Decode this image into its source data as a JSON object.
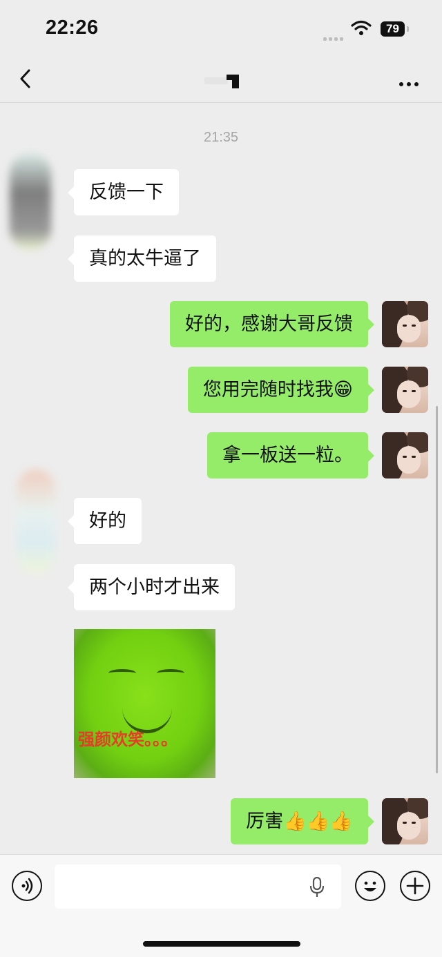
{
  "status_bar": {
    "time": "22:26",
    "battery": "79"
  },
  "chat": {
    "timestamp": "21:35",
    "messages": [
      {
        "side": "in",
        "text": "反馈一下"
      },
      {
        "side": "in",
        "text": "真的太牛逼了"
      },
      {
        "side": "out",
        "text": "好的，感谢大哥反馈"
      },
      {
        "side": "out",
        "text": "您用完随时找我😁"
      },
      {
        "side": "out",
        "text": "拿一板送一粒。"
      },
      {
        "side": "in",
        "text": "好的"
      },
      {
        "side": "in",
        "text": "两个小时才出来"
      },
      {
        "side": "in",
        "type": "sticker",
        "caption": "强颜欢笑。。。"
      },
      {
        "side": "out",
        "text": "厉害👍👍👍"
      }
    ]
  },
  "icons": {
    "back": "chevron-left-icon",
    "more": "more-icon",
    "voice": "voice-icon",
    "mic": "mic-icon",
    "emoji": "emoji-icon",
    "add": "plus-icon"
  }
}
